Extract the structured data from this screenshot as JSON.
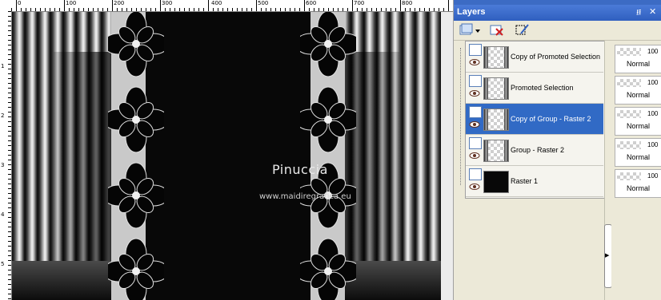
{
  "ruler": {
    "top_labels": [
      "0",
      "100",
      "200",
      "300",
      "400",
      "500",
      "600",
      "700",
      "800"
    ],
    "left_labels": [
      "1",
      "2",
      "3",
      "4",
      "5"
    ]
  },
  "canvas": {
    "signature": "Pinuccia",
    "signature_url": "www.maidiregrafica.eu"
  },
  "palette": {
    "title": "Layers",
    "pin_icon": "pin-icon",
    "close_icon": "close-icon",
    "toolbar": [
      "new-layer-icon",
      "delete-layer-icon",
      "edit-selection-icon"
    ],
    "layers": [
      {
        "name": "Copy of Promoted Selection",
        "opacity": "100",
        "blend": "Normal",
        "selected": false,
        "thumb": "strip"
      },
      {
        "name": "Promoted Selection",
        "opacity": "100",
        "blend": "Normal",
        "selected": false,
        "thumb": "strip"
      },
      {
        "name": "Copy of Group - Raster 2",
        "opacity": "100",
        "blend": "Normal",
        "selected": true,
        "thumb": "strip"
      },
      {
        "name": "Group - Raster 2",
        "opacity": "100",
        "blend": "Normal",
        "selected": false,
        "thumb": "strip"
      },
      {
        "name": "Raster 1",
        "opacity": "100",
        "blend": "Normal",
        "selected": false,
        "thumb": "black"
      }
    ]
  },
  "colors": {
    "titlebar": "#2f5fbf",
    "selection": "#316ac5",
    "panel": "#ece9d8"
  }
}
